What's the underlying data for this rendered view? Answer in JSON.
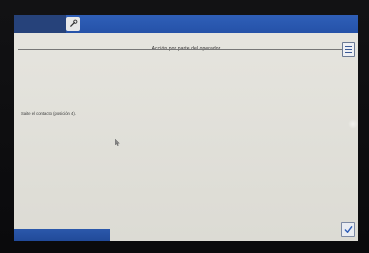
{
  "window": {
    "title": "Acción por parte del operador"
  },
  "main": {
    "message": "Saite el contacto (posición 4)."
  },
  "icons": {
    "tool": "wrench-icon",
    "menu": "menu-icon",
    "confirm": "checkmark-icon",
    "cursor": "mouse-cursor-icon"
  },
  "colors": {
    "header_blue": "#2f5fb8",
    "header_dark": "#26427a",
    "screen_bg": "#e2e1db",
    "accent_check": "#2f5fb8"
  }
}
